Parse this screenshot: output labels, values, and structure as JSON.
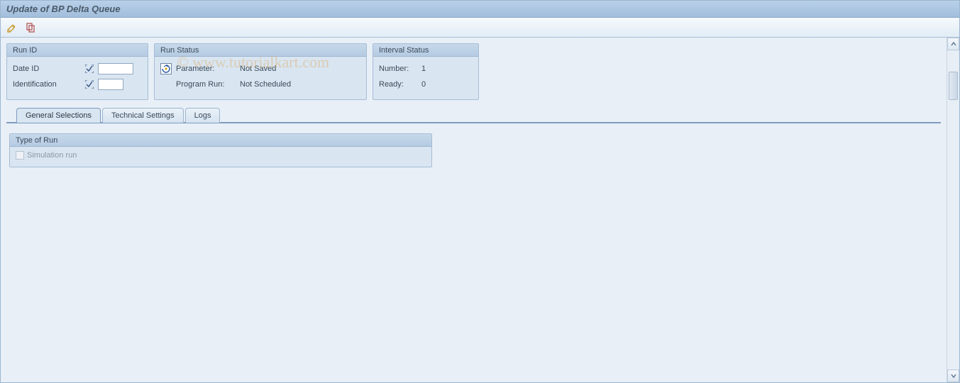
{
  "window": {
    "title": "Update of BP Delta Queue"
  },
  "toolbar": {
    "edit_icon": "edit-icon",
    "copy_icon": "copy-icon"
  },
  "panels": {
    "run_id": {
      "title": "Run ID",
      "date_id_label": "Date ID",
      "date_id_value": "",
      "identification_label": "Identification",
      "identification_value": ""
    },
    "run_status": {
      "title": "Run Status",
      "parameter_label": "Parameter:",
      "parameter_value": "Not Saved",
      "program_run_label": "Program Run:",
      "program_run_value": "Not Scheduled"
    },
    "interval_status": {
      "title": "Interval Status",
      "number_label": "Number:",
      "number_value": "1",
      "ready_label": "Ready:",
      "ready_value": "0"
    }
  },
  "tabs": {
    "general_selections": "General Selections",
    "technical_settings": "Technical Settings",
    "logs": "Logs",
    "active": "general_selections"
  },
  "type_of_run": {
    "title": "Type of Run",
    "simulation_run_label": "Simulation run",
    "simulation_run_checked": false,
    "simulation_run_enabled": false
  },
  "watermark": {
    "text": "© www.tutorialkart.com"
  }
}
